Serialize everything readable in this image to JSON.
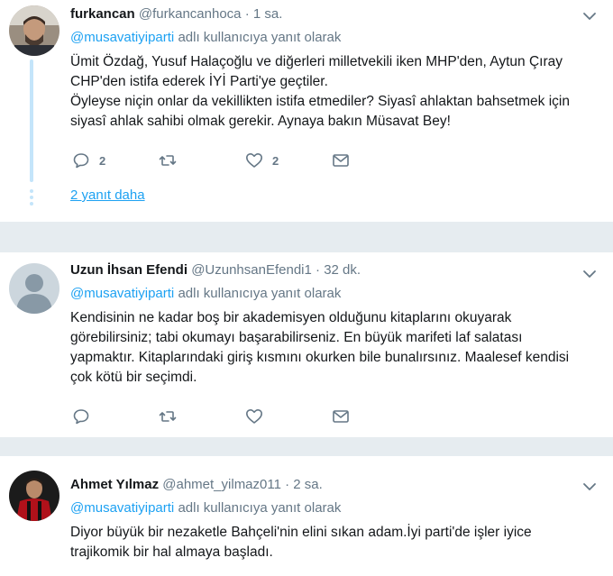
{
  "tweets": [
    {
      "name": "furkancan",
      "handle": "@furkancanhoca",
      "separator": "·",
      "time": "1 sa.",
      "reply_to": "@musavatiyiparti",
      "reply_suffix": "adlı kullanıcıya yanıt olarak",
      "text_lines": [
        "Ümit Özdağ, Yusuf Halaçoğlu ve diğerleri milletvekili iken MHP'den, Aytun Çıray",
        "CHP'den istifa ederek İYİ Parti'ye geçtiler.",
        "Öyleyse niçin onlar da vekillikten istifa etmediler? Siyasî ahlaktan bahsetmek için",
        "siyasî ahlak sahibi olmak gerekir. Aynaya bakın Müsavat Bey!"
      ],
      "reply_count": "2",
      "retweet_count": "",
      "like_count": "2",
      "more_replies": "2 yanıt daha"
    },
    {
      "name": "Uzun İhsan Efendi",
      "handle": "@UzunhsanEfendi1",
      "separator": "·",
      "time": "32 dk.",
      "reply_to": "@musavatiyiparti",
      "reply_suffix": "adlı kullanıcıya yanıt olarak",
      "text_lines": [
        "Kendisinin ne kadar boş bir akademisyen olduğunu kitaplarını okuyarak",
        "görebilirsiniz; tabi okumayı başarabilirseniz. En büyük marifeti laf salatası",
        "yapmaktır. Kitaplarındaki giriş kısmını okurken bile bunalırsınız. Maalesef kendisi",
        "çok kötü bir seçimdi."
      ],
      "reply_count": "",
      "retweet_count": "",
      "like_count": ""
    },
    {
      "name": "Ahmet Yılmaz",
      "handle": "@ahmet_yilmaz011",
      "separator": "·",
      "time": "2 sa.",
      "reply_to": "@musavatiyiparti",
      "reply_suffix": "adlı kullanıcıya yanıt olarak",
      "text_lines": [
        "Diyor büyük bir nezaketle Bahçeli'nin elini sıkan adam.İyi parti'de işler iyice",
        "trajikomik bir hal almaya başladı."
      ]
    }
  ],
  "colors": {
    "link": "#1da1f2",
    "muted": "#657786",
    "text": "#14171a",
    "separator": "#e6ecf0",
    "thread": "#c4e5fa"
  },
  "icons": [
    "reply-icon",
    "retweet-icon",
    "like-icon",
    "dm-icon",
    "chevron-down-icon"
  ]
}
